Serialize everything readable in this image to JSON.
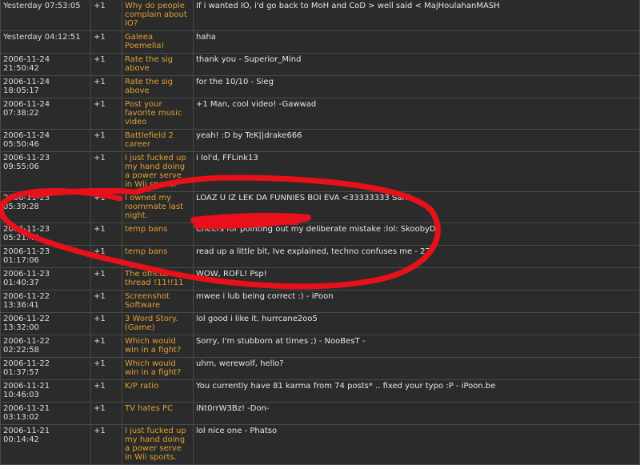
{
  "karma_log": {
    "rows": [
      {
        "date": "Yesterday 07:53:05",
        "points": "+1",
        "thread": "Why do people complain about IO?",
        "comment": "If i wanted IO, i'd go back to MoH and CoD > well said < MajHoulahanMASH"
      },
      {
        "date": "Yesterday 04:12:51",
        "points": "+1",
        "thread": "Galeea Poemella!",
        "comment": "haha"
      },
      {
        "date": "2006-11-24 21:50:42",
        "points": "+1",
        "thread": "Rate the sig above",
        "comment": "thank you - Superior_Mind"
      },
      {
        "date": "2006-11-24 18:05:17",
        "points": "+1",
        "thread": "Rate the sig above",
        "comment": "for the 10/10 - Sieg"
      },
      {
        "date": "2006-11-24 07:38:22",
        "points": "+1",
        "thread": "Post your favorite music video",
        "comment": "+1 Man, cool video! -Gawwad"
      },
      {
        "date": "2006-11-24 05:50:46",
        "points": "+1",
        "thread": "Battlefield 2 career",
        "comment": "yeah! :D by TeK||drake666"
      },
      {
        "date": "2006-11-23 09:55:06",
        "points": "+1",
        "thread": "I just fucked up my hand doing a power serve in Wii sports.",
        "comment": "i lol'd, FFLink13"
      },
      {
        "date": "2006-11-23 05:39:28",
        "points": "+1",
        "thread": "I owned my roommate last night.",
        "comment": "LOAZ U IZ LEK DA FUNNIES BOI EVA <33333333 Sarrk"
      },
      {
        "date": "2006-11-23 05:21:40",
        "points": "+1",
        "thread": "temp bans",
        "comment": "Cheers for pointing out my deliberate mistake :lol: SkoobyDo"
      },
      {
        "date": "2006-11-23 01:17:06",
        "points": "+1",
        "thread": "temp bans",
        "comment": "read up a little bit, Ive explained, techno confuses me - 27"
      },
      {
        "date": "2006-11-23 01:40:37",
        "points": "+1",
        "thread": "The official thread !11!!11",
        "comment": "WOW, ROFL! Psp!"
      },
      {
        "date": "2006-11-22 13:36:41",
        "points": "+1",
        "thread": "Screenshot Software",
        "comment": "mwee i lub being correct :) - iPoon"
      },
      {
        "date": "2006-11-22 13:32:00",
        "points": "+1",
        "thread": "3 Word Story. (Game)",
        "comment": "lol good i like it. hurrcane2oo5"
      },
      {
        "date": "2006-11-22 02:22:58",
        "points": "+1",
        "thread": "Which would win in a fight?",
        "comment": "Sorry, I'm stubborn at times ;) - NooBesT -"
      },
      {
        "date": "2006-11-22 01:37:57",
        "points": "+1",
        "thread": "Which would win in a fight?",
        "comment": "uhm, werewolf, hello?"
      },
      {
        "date": "2006-11-21 10:46:03",
        "points": "+1",
        "thread": "K/P ratio",
        "comment": "You currently have 81 karma from 74 posts* .. fixed your typo :P - iPoon.be"
      },
      {
        "date": "2006-11-21 03:13:02",
        "points": "+1",
        "thread": "TV hates PC",
        "comment": "iNt0rrW3Bz! -Don-"
      },
      {
        "date": "2006-11-21 00:14:42",
        "points": "+1",
        "thread": "I just fucked up my hand doing a power serve in Wii sports.",
        "comment": "lol nice one - Phatso"
      }
    ]
  },
  "colors": {
    "background": "#2b2b2b",
    "border": "#4a4a4a",
    "thread_link": "#e0a030",
    "text": "#dcdcdc",
    "annotation": "#e8101a"
  }
}
